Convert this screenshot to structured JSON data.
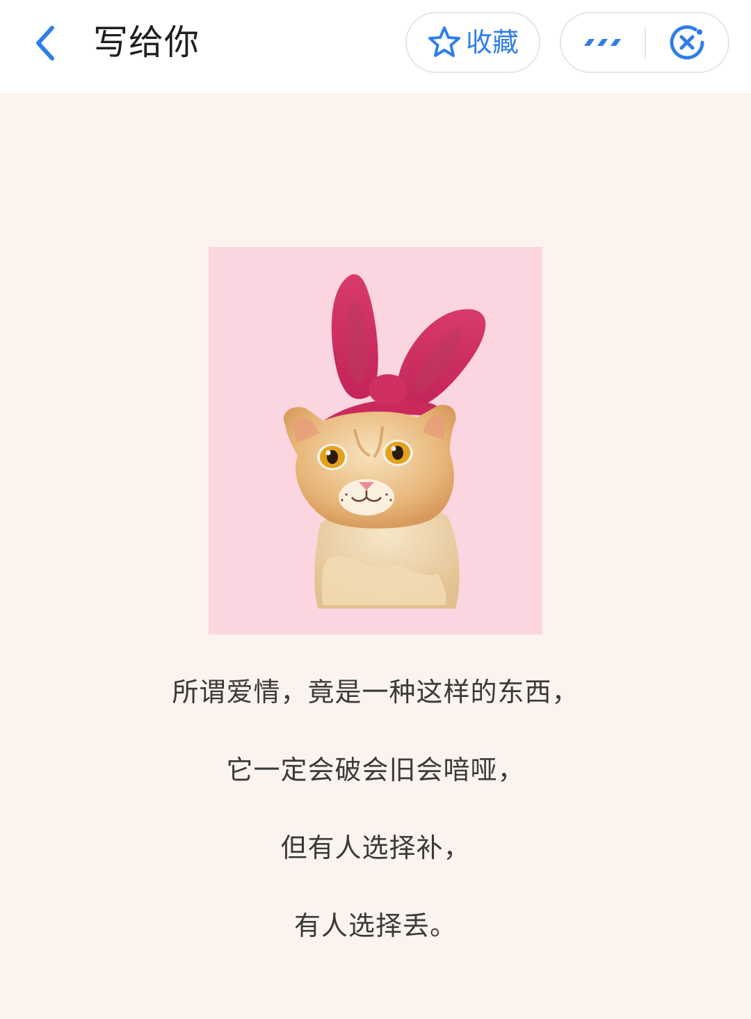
{
  "header": {
    "title": "写给你",
    "favorite_label": "收藏",
    "accent_color": "#2f7ee8",
    "icons": {
      "back": "chevron-left-icon",
      "favorite": "star-outline-icon",
      "more": "more-dots-icon",
      "close": "close-circle-icon"
    }
  },
  "content": {
    "image": {
      "description_icon": "cat-with-bunny-ears-illustration",
      "background_color": "#fbd5df"
    },
    "poem_lines": [
      "所谓爱情，竟是一种这样的东西，",
      "它一定会破会旧会喑哑，",
      "但有人选择补，",
      "有人选择丢。"
    ]
  }
}
